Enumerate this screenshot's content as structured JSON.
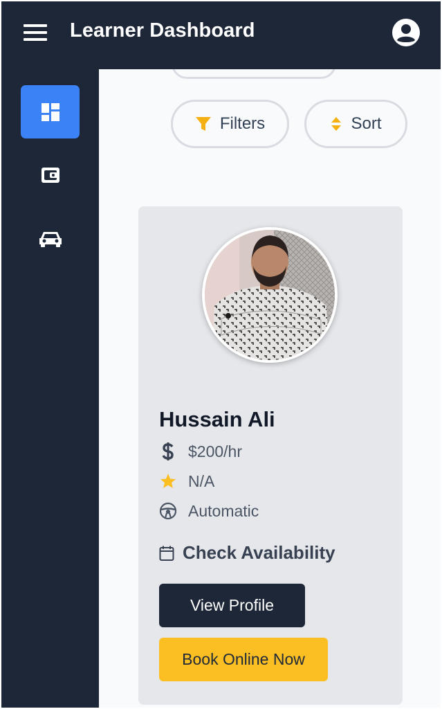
{
  "header": {
    "title": "Learner Dashboard",
    "menu_icon": "hamburger-icon",
    "profile_icon": "account-circle-icon"
  },
  "sidebar": {
    "items": [
      {
        "icon": "dashboard-icon",
        "active": true
      },
      {
        "icon": "wallet-icon",
        "active": false
      },
      {
        "icon": "car-icon",
        "active": false
      }
    ]
  },
  "toolbar": {
    "filters_label": "Filters",
    "sort_label": "Sort"
  },
  "instructor": {
    "name": "Hussain Ali",
    "price": "$200/hr",
    "rating": "N/A",
    "transmission": "Automatic",
    "availability_label": "Check Availability",
    "view_profile_label": "View Profile",
    "book_label": "Book Online Now"
  },
  "colors": {
    "navy": "#1e2738",
    "accent_blue": "#3b82f6",
    "accent_yellow": "#fbbf24",
    "card_bg": "#e5e7eb"
  }
}
